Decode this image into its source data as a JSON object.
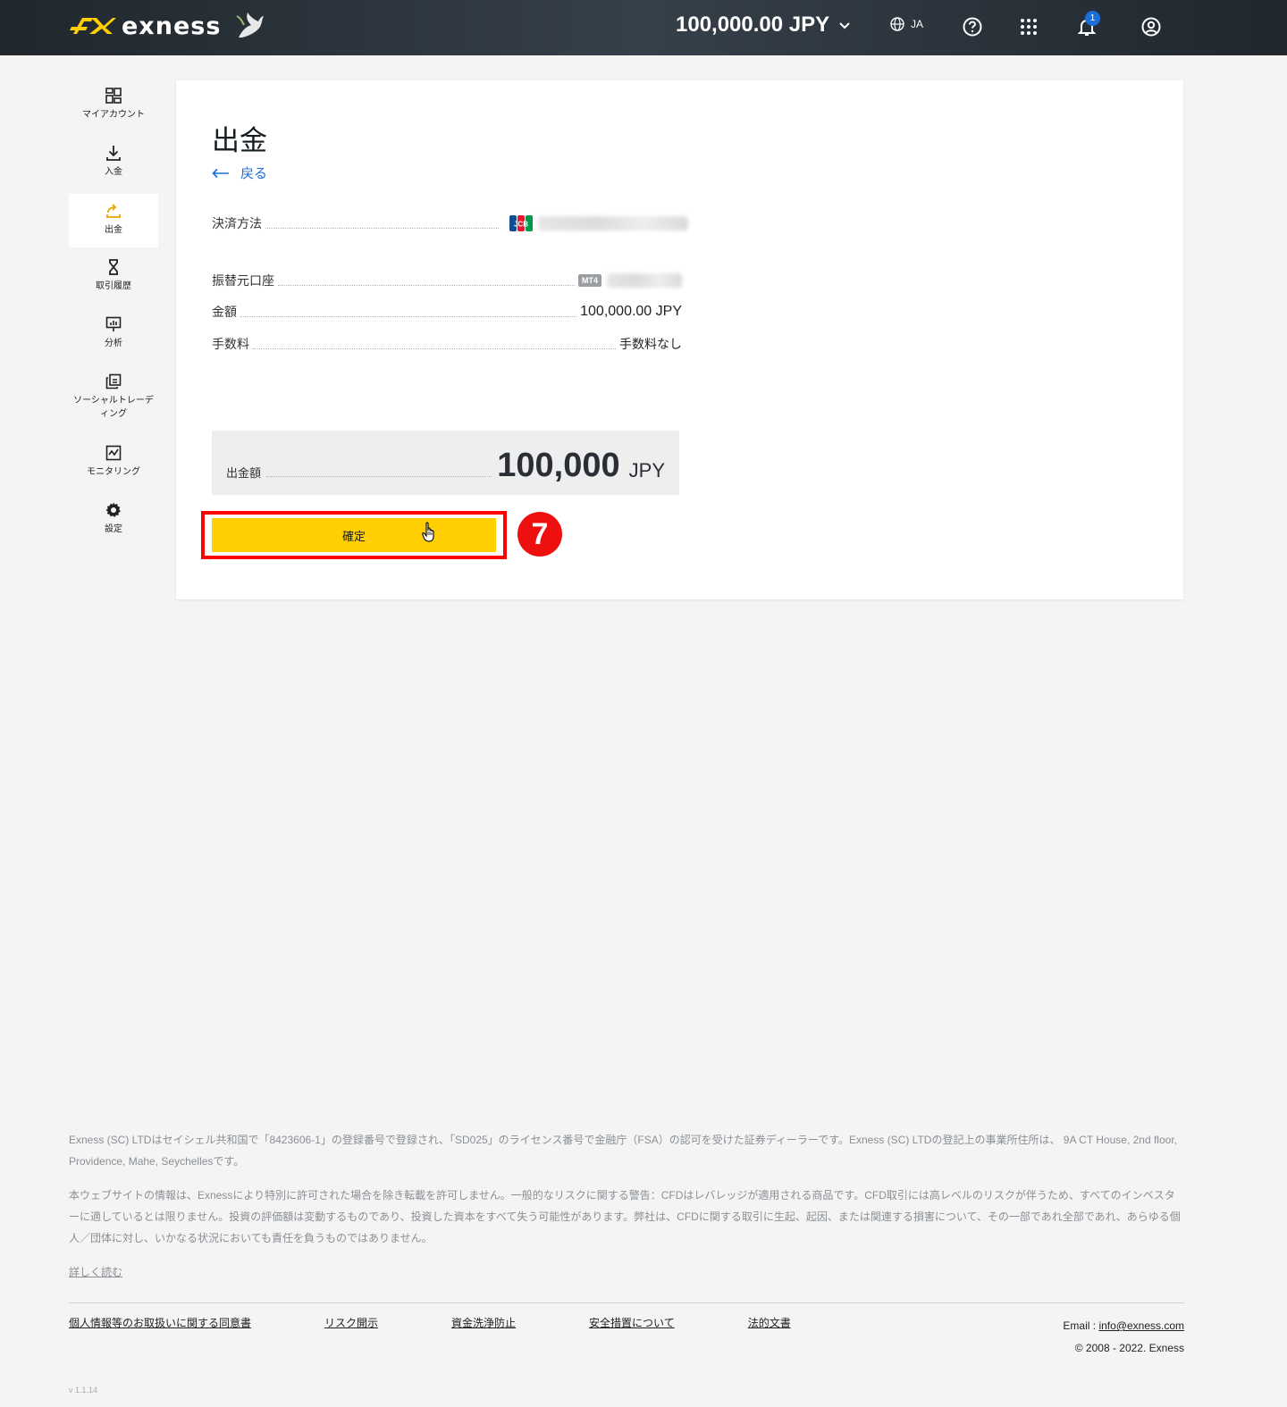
{
  "header": {
    "logo_text": "exness",
    "balance": "100,000.00 JPY",
    "language": "JA",
    "notification_count": "1"
  },
  "sidebar": {
    "items": [
      {
        "label": "マイアカウント",
        "icon": "dashboard-icon"
      },
      {
        "label": "入金",
        "icon": "download-icon"
      },
      {
        "label": "出金",
        "icon": "upload-icon",
        "active": true
      },
      {
        "label": "取引履歴",
        "icon": "hourglass-icon"
      },
      {
        "label": "分析",
        "icon": "presentation-icon"
      },
      {
        "label": "ソーシャルトレーディング",
        "icon": "copy-icon"
      },
      {
        "label": "モニタリング",
        "icon": "chart-icon"
      },
      {
        "label": "設定",
        "icon": "gear-icon"
      }
    ]
  },
  "main": {
    "title": "出金",
    "back_label": "戻る",
    "payment_method_label": "決済方法",
    "source_account_label": "振替元口座",
    "source_account_badge": "MT4",
    "amount_label": "金額",
    "amount_value": "100,000.00 JPY",
    "fee_label": "手数料",
    "fee_value": "手数料なし",
    "summary_label": "出金額",
    "summary_amount": "100,000",
    "summary_currency": "JPY",
    "confirm_label": "確定",
    "step_number": "7"
  },
  "footer": {
    "paragraph1": "Exness (SC) LTDはセイシェル共和国で「8423606-1」の登録番号で登録され、「SD025」のライセンス番号で金融庁（FSA）の認可を受けた証券ディーラーです。Exness (SC) LTDの登記上の事業所住所は、 9A CT House, 2nd floor, Providence, Mahe, Seychellesです。",
    "paragraph2": "本ウェブサイトの情報は、Exnessにより特別に許可された場合を除き転載を許可しません。一般的なリスクに関する警告：CFDはレバレッジが適用される商品です。CFD取引には高レベルのリスクが伴うため、すべてのインベスターに適しているとは限りません。投資の評価額は変動するものであり、投資した資本をすべて失う可能性があります。弊社は、CFDに関する取引に生起、起因、または関連する損害について、その一部であれ全部であれ、あらゆる個人／団体に対し、いかなる状況においても責任を負うものではありません。",
    "read_more": "詳しく読む",
    "links": [
      "個人情報等のお取扱いに関する同意書",
      "リスク開示",
      "資金洗浄防止",
      "安全措置について",
      "法的文書"
    ],
    "email_label": "Email : ",
    "email": "info@exness.com",
    "copyright": "© 2008 - 2022. Exness",
    "version": "v 1.1.14"
  },
  "colors": {
    "accent": "#ffcf01",
    "link": "#1a6ed8",
    "highlight": "#ff0000"
  }
}
